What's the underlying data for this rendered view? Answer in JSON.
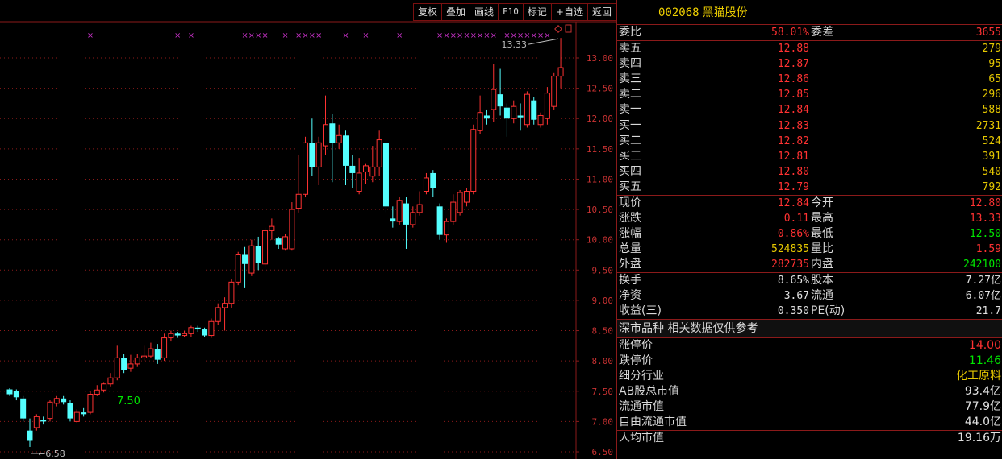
{
  "toolbar": {
    "buttons": [
      "复权",
      "叠加",
      "画线",
      "F10",
      "标记",
      "+自选",
      "返回"
    ]
  },
  "chart_data": {
    "type": "candlestick",
    "ylim": [
      6.5,
      13.5
    ],
    "y_ticks": [
      "13.00",
      "12.50",
      "12.00",
      "11.50",
      "11.00",
      "10.50",
      "10.00",
      "9.50",
      "9.00",
      "8.50",
      "8.00",
      "7.50",
      "7.00",
      "6.50"
    ],
    "candles": [
      [
        7.53,
        7.45,
        7.55,
        7.42
      ],
      [
        7.5,
        7.4,
        7.53,
        7.35
      ],
      [
        7.38,
        7.05,
        7.42,
        7.0
      ],
      [
        6.85,
        6.68,
        7.05,
        6.58
      ],
      [
        6.9,
        7.08,
        7.12,
        6.85
      ],
      [
        7.03,
        7.0,
        7.08,
        6.95
      ],
      [
        7.05,
        7.32,
        7.35,
        7.0
      ],
      [
        7.3,
        7.38,
        7.42,
        7.25
      ],
      [
        7.38,
        7.32,
        7.42,
        7.28
      ],
      [
        7.3,
        7.05,
        7.35,
        7.0
      ],
      [
        7.0,
        7.15,
        7.2,
        6.98
      ],
      [
        7.15,
        7.12,
        7.22,
        7.08
      ],
      [
        7.15,
        7.45,
        7.5,
        7.12
      ],
      [
        7.45,
        7.52,
        7.6,
        7.42
      ],
      [
        7.52,
        7.62,
        7.65,
        7.48
      ],
      [
        7.62,
        7.72,
        7.8,
        7.58
      ],
      [
        7.72,
        8.05,
        8.25,
        7.68
      ],
      [
        8.05,
        7.85,
        8.12,
        7.8
      ],
      [
        7.88,
        7.95,
        8.1,
        7.82
      ],
      [
        7.95,
        8.05,
        8.12,
        7.9
      ],
      [
        8.05,
        8.08,
        8.25,
        8.0
      ],
      [
        8.08,
        8.2,
        8.3,
        8.05
      ],
      [
        8.2,
        8.02,
        8.28,
        7.95
      ],
      [
        8.05,
        8.38,
        8.45,
        8.0
      ],
      [
        8.38,
        8.45,
        8.5,
        8.32
      ],
      [
        8.45,
        8.42,
        8.48,
        8.38
      ],
      [
        8.42,
        8.45,
        8.5,
        8.4
      ],
      [
        8.45,
        8.55,
        8.58,
        8.4
      ],
      [
        8.55,
        8.52,
        8.58,
        8.48
      ],
      [
        8.52,
        8.42,
        8.55,
        8.4
      ],
      [
        8.42,
        8.65,
        8.7,
        8.38
      ],
      [
        8.65,
        8.88,
        8.95,
        8.6
      ],
      [
        8.88,
        8.95,
        9.05,
        8.5
      ],
      [
        8.95,
        9.3,
        9.35,
        8.88
      ],
      [
        9.3,
        9.75,
        9.8,
        9.25
      ],
      [
        9.75,
        9.6,
        9.88,
        9.2
      ],
      [
        9.45,
        9.9,
        10.0,
        9.4
      ],
      [
        9.9,
        9.62,
        10.05,
        9.5
      ],
      [
        9.6,
        10.15,
        10.2,
        9.55
      ],
      [
        10.15,
        10.22,
        10.35,
        10.0
      ],
      [
        10.02,
        9.92,
        10.05,
        9.85
      ],
      [
        9.85,
        10.05,
        10.1,
        9.82
      ],
      [
        9.85,
        10.5,
        10.62,
        9.82
      ],
      [
        10.52,
        10.75,
        11.4,
        10.45
      ],
      [
        10.75,
        11.6,
        11.7,
        10.7
      ],
      [
        11.6,
        11.2,
        12.0,
        11.05
      ],
      [
        11.2,
        11.6,
        11.7,
        10.9
      ],
      [
        11.55,
        11.9,
        12.38,
        11.4
      ],
      [
        11.92,
        11.6,
        12.08,
        10.95
      ],
      [
        11.6,
        11.72,
        11.9,
        11.5
      ],
      [
        11.72,
        11.22,
        11.8,
        10.9
      ],
      [
        11.22,
        11.1,
        11.4,
        10.85
      ],
      [
        10.8,
        11.1,
        11.35,
        10.75
      ],
      [
        11.12,
        11.22,
        11.25,
        10.92
      ],
      [
        11.05,
        11.2,
        11.55,
        10.95
      ],
      [
        11.2,
        11.65,
        11.8,
        11.05
      ],
      [
        11.6,
        10.55,
        11.6,
        10.45
      ],
      [
        10.35,
        10.3,
        10.55,
        10.2
      ],
      [
        10.3,
        10.65,
        10.7,
        10.25
      ],
      [
        10.6,
        10.25,
        10.7,
        9.85
      ],
      [
        10.25,
        10.45,
        10.55,
        10.2
      ],
      [
        10.45,
        10.58,
        10.8,
        10.4
      ],
      [
        10.8,
        11.02,
        11.1,
        10.75
      ],
      [
        11.1,
        10.85,
        11.15,
        10.7
      ],
      [
        10.55,
        10.08,
        10.6,
        10.0
      ],
      [
        10.08,
        10.3,
        10.35,
        9.95
      ],
      [
        10.3,
        10.62,
        10.75,
        10.25
      ],
      [
        10.45,
        10.78,
        10.82,
        10.4
      ],
      [
        10.62,
        10.8,
        10.85,
        10.55
      ],
      [
        10.8,
        11.82,
        11.9,
        10.75
      ],
      [
        11.8,
        12.1,
        12.38,
        11.75
      ],
      [
        12.05,
        12.0,
        12.15,
        11.9
      ],
      [
        12.15,
        12.48,
        12.9,
        11.95
      ],
      [
        12.4,
        12.2,
        12.82,
        12.05
      ],
      [
        12.18,
        12.0,
        12.25,
        11.7
      ],
      [
        12.0,
        12.2,
        12.3,
        11.92
      ],
      [
        12.05,
        12.02,
        12.25,
        11.8
      ],
      [
        11.9,
        12.4,
        12.45,
        11.85
      ],
      [
        12.3,
        11.98,
        12.35,
        11.9
      ],
      [
        11.9,
        12.05,
        12.1,
        11.85
      ],
      [
        12.0,
        12.42,
        12.52,
        11.9
      ],
      [
        12.2,
        12.7,
        12.75,
        12.15
      ],
      [
        12.7,
        12.84,
        13.33,
        12.5
      ]
    ],
    "annotations": {
      "high_label": "13.33",
      "low_label": "6.58",
      "mid_label": "7.50"
    }
  },
  "quote": {
    "code": "002068",
    "name": "黑猫股份",
    "weibi_label": "委比",
    "weibi": "58.01%",
    "weicha_label": "委差",
    "weicha": "3655",
    "sells": [
      {
        "label": "卖五",
        "price": "12.88",
        "vol": "279"
      },
      {
        "label": "卖四",
        "price": "12.87",
        "vol": "95"
      },
      {
        "label": "卖三",
        "price": "12.86",
        "vol": "65"
      },
      {
        "label": "卖二",
        "price": "12.85",
        "vol": "296"
      },
      {
        "label": "卖一",
        "price": "12.84",
        "vol": "588"
      }
    ],
    "buys": [
      {
        "label": "买一",
        "price": "12.83",
        "vol": "2731"
      },
      {
        "label": "买二",
        "price": "12.82",
        "vol": "524"
      },
      {
        "label": "买三",
        "price": "12.81",
        "vol": "391"
      },
      {
        "label": "买四",
        "price": "12.80",
        "vol": "540"
      },
      {
        "label": "买五",
        "price": "12.79",
        "vol": "792"
      }
    ],
    "stats": [
      {
        "l1": "现价",
        "v1": "12.84",
        "c1": "red",
        "l2": "今开",
        "v2": "12.80",
        "c2": "red"
      },
      {
        "l1": "涨跌",
        "v1": "0.11",
        "c1": "red",
        "l2": "最高",
        "v2": "13.33",
        "c2": "red"
      },
      {
        "l1": "涨幅",
        "v1": "0.86%",
        "c1": "red",
        "l2": "最低",
        "v2": "12.50",
        "c2": "green"
      },
      {
        "l1": "总量",
        "v1": "524835",
        "c1": "yellow",
        "l2": "量比",
        "v2": "1.59",
        "c2": "red"
      },
      {
        "l1": "外盘",
        "v1": "282735",
        "c1": "red",
        "l2": "内盘",
        "v2": "242100",
        "c2": "green"
      }
    ],
    "finance": [
      {
        "l1": "换手",
        "v1": "8.65%",
        "l2": "股本",
        "v2": "7.27亿"
      },
      {
        "l1": "净资",
        "v1": "3.67",
        "l2": "流通",
        "v2": "6.07亿"
      },
      {
        "l1": "收益(三)",
        "v1": "0.350",
        "l2": "PE(动)",
        "v2": "21.7"
      }
    ],
    "note": "深市品种  相关数据仅供参考",
    "limit_up_label": "涨停价",
    "limit_up": "14.00",
    "limit_down_label": "跌停价",
    "limit_down": "11.46",
    "industry_label": "细分行业",
    "industry": "化工原料",
    "ab_mv_label": "AB股总市值",
    "ab_mv": "93.4亿",
    "float_mv_label": "流通市值",
    "float_mv": "77.9亿",
    "free_mv_label": "自由流通市值",
    "free_mv": "44.0亿",
    "avg_mv_label": "人均市值",
    "avg_mv": "19.16万"
  },
  "colors": {
    "up": "#ff3232",
    "down": "#54ffff",
    "grid": "#8b1a1a",
    "marker": "#c832c8"
  }
}
